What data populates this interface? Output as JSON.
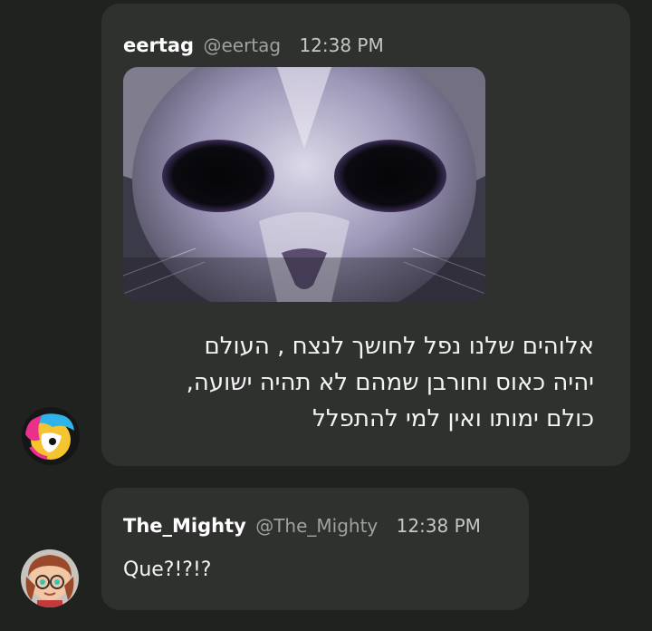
{
  "messages": [
    {
      "author": "eertag",
      "handle": "@eertag",
      "time": "12:38 PM",
      "attachment": "cat-photo",
      "text_lines": [
        "אלוהים שלנו נפל לחושך לנצח , העולם",
        "יהיה כאוס וחורבן שמהם לא תהיה ישועה,",
        "כולם ימותו ואין למי להתפלל"
      ]
    },
    {
      "author": "The_Mighty",
      "handle": "@The_Mighty",
      "time": "12:38 PM",
      "text": "Que?!?!?"
    }
  ],
  "colors": {
    "background": "#1f221f",
    "bubble": "#2e312e",
    "name": "#ffffff",
    "handle": "#9ea39e"
  }
}
